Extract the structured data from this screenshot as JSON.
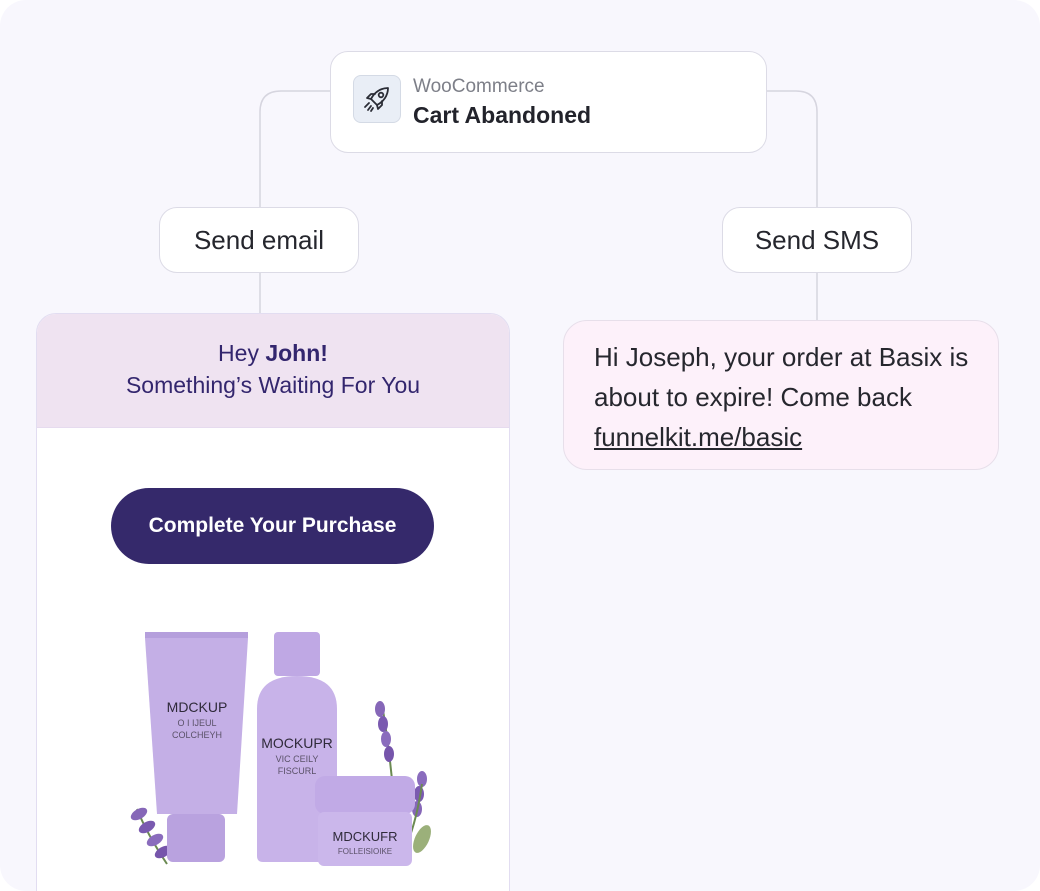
{
  "trigger": {
    "icon": "rocket-icon",
    "platform": "WooCommerce",
    "event": "Cart Abandoned"
  },
  "actions": {
    "email_label": "Send email",
    "sms_label": "Send SMS"
  },
  "email": {
    "greeting_prefix": "Hey ",
    "greeting_name": "John!",
    "tagline": "Something’s Waiting For You",
    "cta_label": "Complete Your Purchase",
    "product": {
      "tube_label": "MDCKUP",
      "tube_sub1": "O I IJEUL",
      "tube_sub2": "COLCHEYH",
      "bottle_label": "MOCKUPR",
      "bottle_sub1": "VIC CEILY",
      "bottle_sub2": "FISCURL",
      "jar_label": "MDCKUFR",
      "jar_sub": "FOLLEISIOIKE"
    }
  },
  "sms": {
    "message": "Hi Joseph, your order at Basix is about to expire! Come back",
    "link": "funnelkit.me/basic"
  },
  "colors": {
    "canvas": "#f8f7fd",
    "accent": "#35296b",
    "email_header": "#efe3f1",
    "sms_bubble": "#fdf1fa",
    "product_purple": "#c4afe6"
  }
}
